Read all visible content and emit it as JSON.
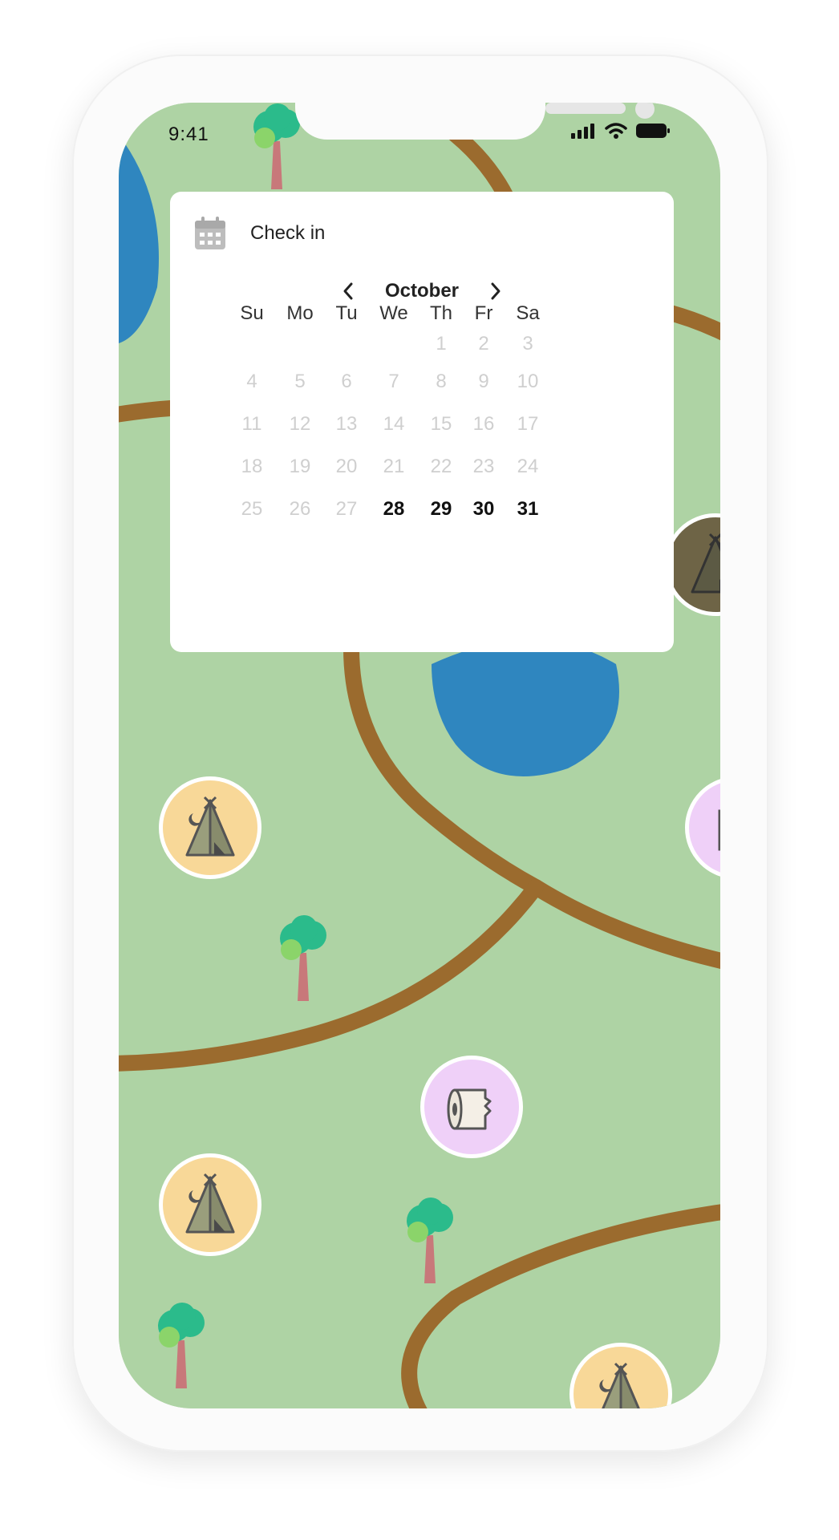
{
  "status_bar": {
    "time": "9:41"
  },
  "calendar": {
    "title": "Check in",
    "month": "October",
    "weekdays": [
      "Su",
      "Mo",
      "Tu",
      "We",
      "Th",
      "Fr",
      "Sa"
    ],
    "weeks": [
      [
        "",
        "",
        "",
        "",
        "1",
        "2",
        "3"
      ],
      [
        "4",
        "5",
        "6",
        "7",
        "8",
        "9",
        "10"
      ],
      [
        "11",
        "12",
        "13",
        "14",
        "15",
        "16",
        "17"
      ],
      [
        "18",
        "19",
        "20",
        "21",
        "22",
        "23",
        "24"
      ],
      [
        "25",
        "26",
        "27",
        "28",
        "29",
        "30",
        "31"
      ]
    ],
    "available_days": [
      "28",
      "29",
      "30",
      "31"
    ]
  },
  "map": {
    "markers": [
      "campsite",
      "campsite",
      "campsite",
      "campsite",
      "campsite",
      "toilet",
      "toilet"
    ],
    "colors": {
      "grass": "#aed3a4",
      "trail": "#9b6b2e",
      "water": "#2f86bf",
      "campsite_bg": "#f8d898",
      "toilet_bg": "#efd0f8"
    }
  },
  "icons": {
    "calendar": "calendar-icon",
    "prev": "chevron-left-icon",
    "next": "chevron-right-icon",
    "signal": "cellular-signal-icon",
    "wifi": "wifi-icon",
    "battery": "battery-icon",
    "campsite": "tent-icon",
    "toilet": "toilet-paper-icon",
    "tree": "tree-icon"
  }
}
